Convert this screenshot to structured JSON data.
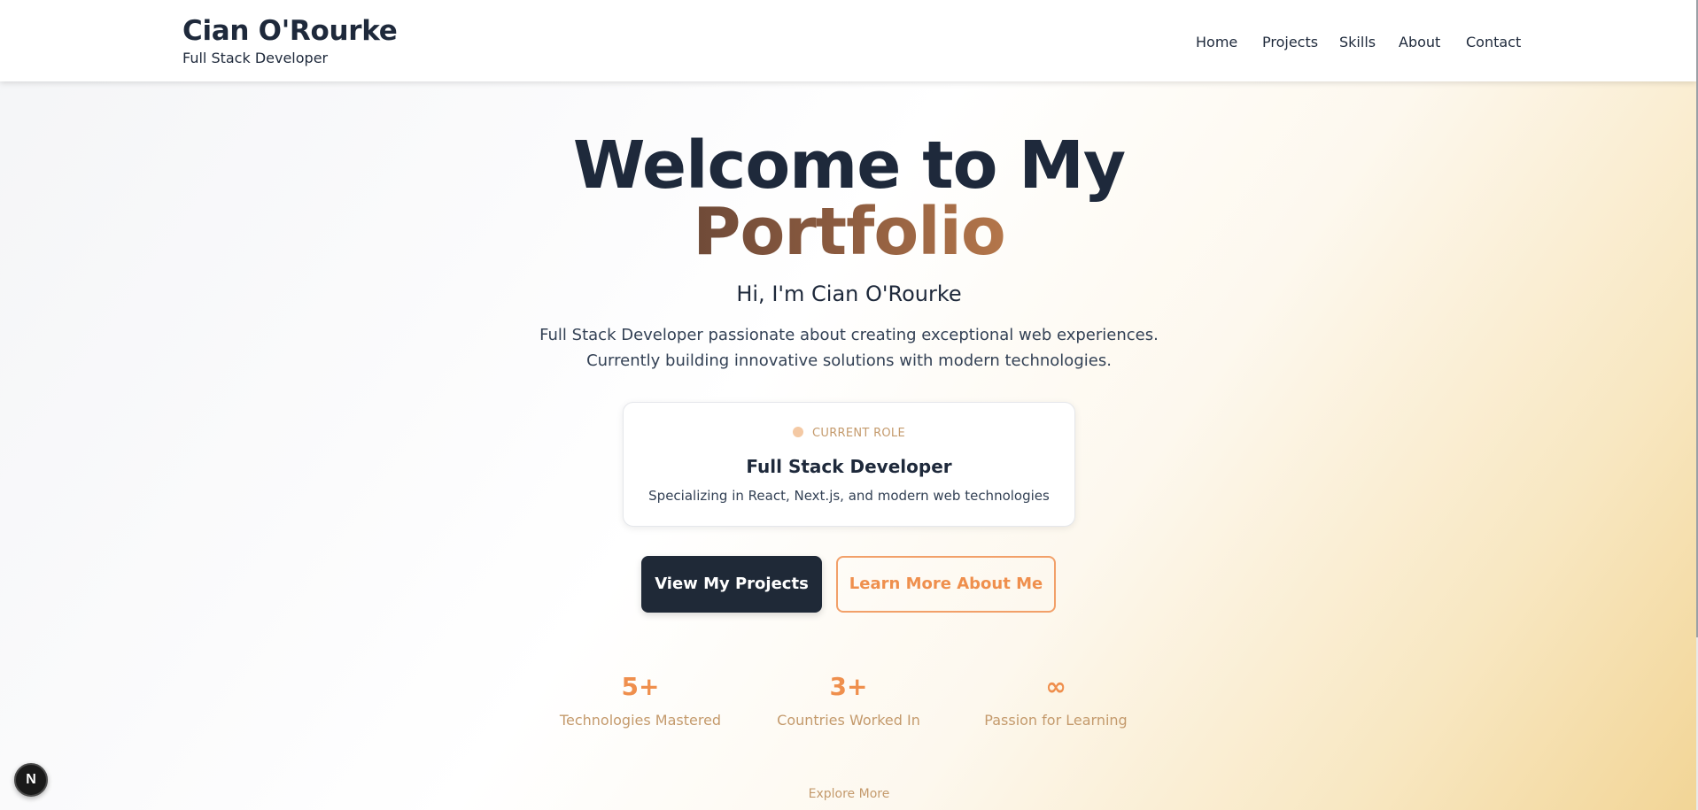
{
  "header": {
    "brand_name": "Cian O'Rourke",
    "brand_subtitle": "Full Stack Developer",
    "nav": [
      {
        "label": "Home"
      },
      {
        "label": "Projects"
      },
      {
        "label": "Skills"
      },
      {
        "label": "About"
      },
      {
        "label": "Contact"
      }
    ]
  },
  "hero": {
    "title_line1": "Welcome to My",
    "title_line2": "Portfolio",
    "greeting_prefix": "Hi, I'm",
    "greeting_name": "Cian O'Rourke",
    "tagline_line1": "Full Stack Developer passionate about creating exceptional web experiences.",
    "tagline_line2": "Currently building innovative solutions with modern technologies."
  },
  "role_card": {
    "label": "CURRENT ROLE",
    "title": "Full Stack Developer",
    "description": "Specializing in React, Next.js, and modern web technologies"
  },
  "buttons": {
    "primary": "View My Projects",
    "secondary": "Learn More About Me"
  },
  "stats": [
    {
      "value": "5+",
      "label": "Technologies Mastered"
    },
    {
      "value": "3+",
      "label": "Countries Worked In"
    },
    {
      "value": "∞",
      "label": "Passion for Learning"
    }
  ],
  "explore_label": "Explore More",
  "badge_letter": "N",
  "colors": {
    "dark": "#1e293b",
    "accent": "#ef8f4d",
    "muted_gold": "#c49a6c"
  }
}
